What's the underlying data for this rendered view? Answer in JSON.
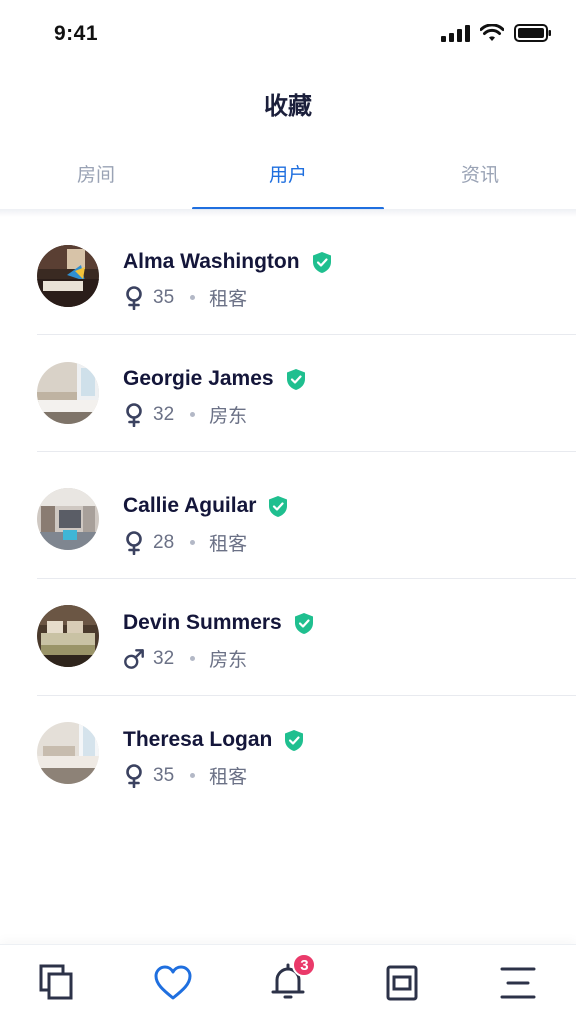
{
  "status_bar": {
    "time": "9:41"
  },
  "header": {
    "title": "收藏"
  },
  "tabs": [
    {
      "label": "房间",
      "active": false
    },
    {
      "label": "用户",
      "active": true
    },
    {
      "label": "资讯",
      "active": false
    }
  ],
  "users": [
    {
      "name": "Alma Washington",
      "gender": "female",
      "age": "35",
      "role": "租客",
      "verified": true
    },
    {
      "name": "Georgie James",
      "gender": "female",
      "age": "32",
      "role": "房东",
      "verified": true
    },
    {
      "name": "Callie Aguilar",
      "gender": "female",
      "age": "28",
      "role": "租客",
      "verified": true
    },
    {
      "name": "Devin Summers",
      "gender": "male",
      "age": "32",
      "role": "房东",
      "verified": true
    },
    {
      "name": "Theresa Logan",
      "gender": "female",
      "age": "35",
      "role": "租客",
      "verified": true
    }
  ],
  "bottom_nav": {
    "items": [
      "copy-icon",
      "heart-icon",
      "bell-icon",
      "frame-icon",
      "menu-icon"
    ],
    "notification_badge": "3"
  },
  "colors": {
    "accent": "#1f6fdf",
    "verified": "#1fbf8f",
    "badge": "#ea3a6a"
  }
}
